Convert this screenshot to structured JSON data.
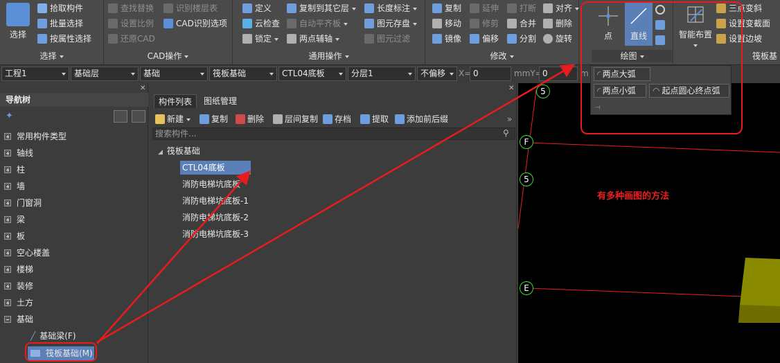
{
  "ribbon": {
    "select": {
      "big": "选择",
      "items": [
        "拾取构件",
        "批量选择",
        "按属性选择"
      ],
      "title": "选择"
    },
    "cad": {
      "items": [
        "查找替换",
        "识别楼层表",
        "设置比例",
        "CAD识别选项",
        "还原CAD"
      ],
      "title": "CAD操作"
    },
    "general": {
      "items": [
        "定义",
        "复制到其它层",
        "长度标注",
        "云检查",
        "自动平齐板",
        "图元存盘",
        "锁定",
        "两点辅轴",
        "图元过滤"
      ],
      "title": "通用操作"
    },
    "modify": {
      "items": [
        "复制",
        "延伸",
        "打断",
        "对齐",
        "移动",
        "修剪",
        "合并",
        "删除",
        "镜像",
        "偏移",
        "分割",
        "旋转"
      ],
      "title": "修改"
    },
    "draw": {
      "point": "点",
      "line": "直线",
      "title": "绘图"
    },
    "smart": {
      "big": "智能布置",
      "items": [
        "三点变斜",
        "设置变截面",
        "设置边坡"
      ],
      "title": "筏板基"
    }
  },
  "propbar": {
    "project": "工程1",
    "floor": "基础层",
    "category": "基础",
    "type": "筏板基础",
    "component": "CTL04底板",
    "layer": "分层1",
    "offset": "不偏移",
    "x_label": "X=",
    "x_value": "0",
    "y_label": "mmY=",
    "y_value": "0",
    "unit": "m"
  },
  "nav": {
    "title": "导航树",
    "items": [
      "常用构件类型",
      "轴线",
      "柱",
      "墙",
      "门窗洞",
      "梁",
      "板",
      "空心楼盖",
      "楼梯",
      "装修",
      "土方",
      "基础"
    ],
    "children": [
      "基础梁(F)",
      "筏板基础(M)"
    ]
  },
  "complist": {
    "tabs": [
      "构件列表",
      "图纸管理"
    ],
    "toolbar": [
      "新建",
      "复制",
      "删除",
      "层间复制",
      "存档",
      "提取",
      "添加前后缀"
    ],
    "search_placeholder": "搜索构件...",
    "group": "筏板基础",
    "items": [
      "CTL04底板",
      "消防电梯坑底板",
      "消防电梯坑底板-1",
      "消防电梯坑底板-2",
      "消防电梯坑底板-3"
    ]
  },
  "canvas": {
    "axes": [
      "5",
      "F",
      "5",
      "E"
    ],
    "annotation": "有多种画图的方法"
  },
  "drawmenu": {
    "items": [
      "两点大弧",
      "两点小弧",
      "起点圆心终点弧"
    ]
  },
  "colors": {
    "highlight": "#e81c1c",
    "selection": "#5b7fb7",
    "axis_circle": "#3cd63c",
    "gridline": "#e82020",
    "slab": "#8a8a00"
  }
}
